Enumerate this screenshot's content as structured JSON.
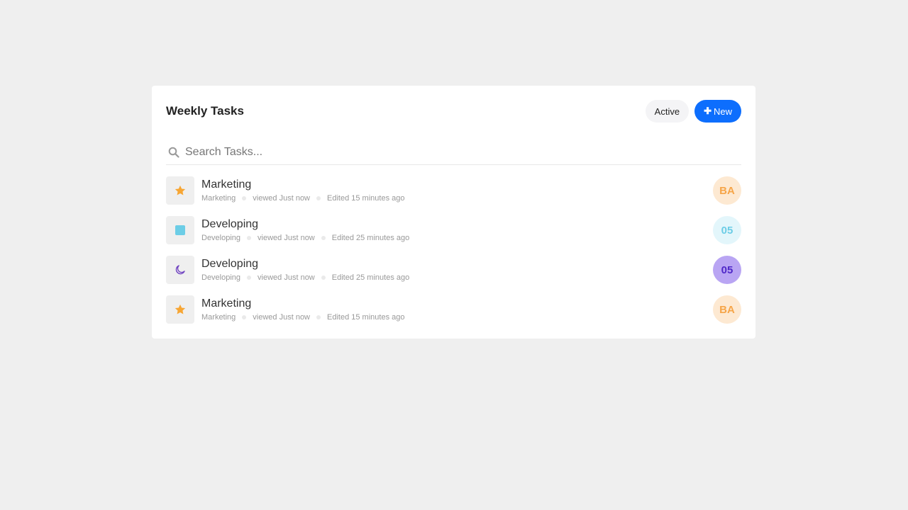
{
  "header": {
    "title": "Weekly Tasks",
    "active_label": "Active",
    "new_label": "New",
    "new_icon": "plus-icon",
    "colors": {
      "primary": "#0d6efd",
      "active_bg": "#f4f4f6"
    }
  },
  "search": {
    "placeholder": "Search Tasks...",
    "value": "",
    "icon": "search-icon"
  },
  "tasks": [
    {
      "name": "Marketing",
      "category": "Marketing",
      "viewed": "viewed Just now",
      "edited": "Edited 15 minutes ago",
      "icon": "star-icon",
      "icon_color": "#f7a634",
      "avatar": "BA",
      "avatar_bg": "#fde9d2",
      "avatar_fg": "#f6a548"
    },
    {
      "name": "Developing",
      "category": "Developing",
      "viewed": "viewed Just now",
      "edited": "Edited 25 minutes ago",
      "icon": "square-icon",
      "icon_color": "#6ccde6",
      "avatar": "05",
      "avatar_bg": "#e3f6fb",
      "avatar_fg": "#6ccde6"
    },
    {
      "name": "Developing",
      "category": "Developing",
      "viewed": "viewed Just now",
      "edited": "Edited 25 minutes ago",
      "icon": "moon-icon",
      "icon_color": "#6f42c1",
      "avatar": "05",
      "avatar_bg": "#b9a5f3",
      "avatar_fg": "#4f28c8"
    },
    {
      "name": "Marketing",
      "category": "Marketing",
      "viewed": "viewed Just now",
      "edited": "Edited 15 minutes ago",
      "icon": "star-icon",
      "icon_color": "#f7a634",
      "avatar": "BA",
      "avatar_bg": "#fde9d2",
      "avatar_fg": "#f6a548"
    }
  ]
}
